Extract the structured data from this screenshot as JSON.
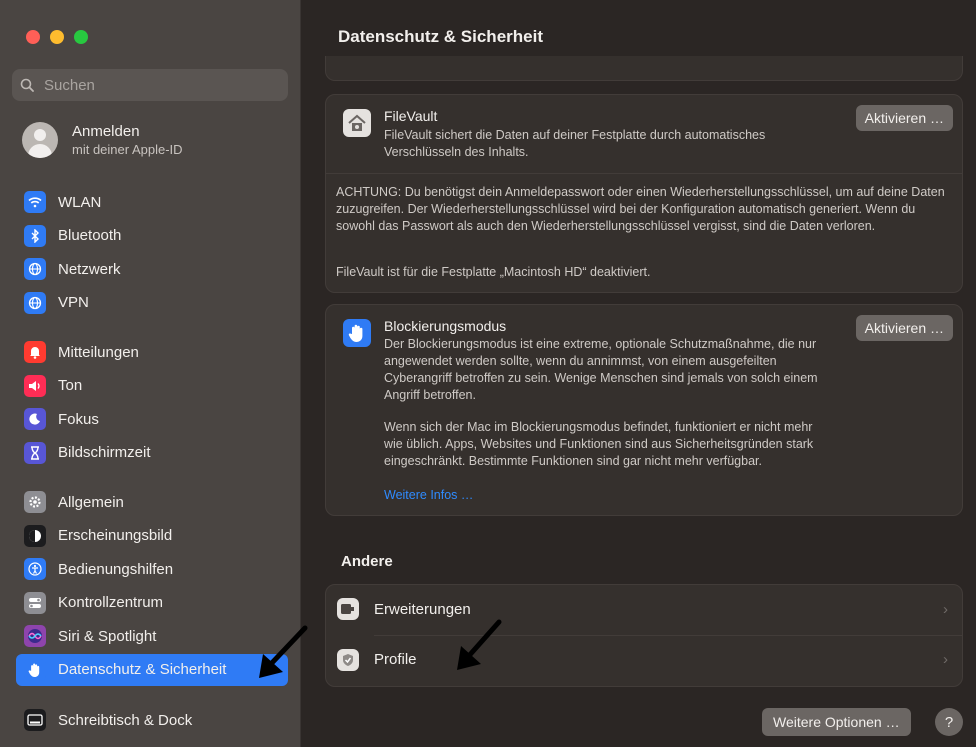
{
  "colors": {
    "accent": "#2f7bf5",
    "traffic_red": "#ff5f57",
    "traffic_yellow": "#febc2e",
    "traffic_green": "#28c840"
  },
  "sidebar": {
    "search_placeholder": "Suchen",
    "account": {
      "title": "Anmelden",
      "subtitle": "mit deiner Apple-ID"
    },
    "groups": [
      [
        {
          "label": "WLAN",
          "icon": "wifi-icon",
          "color": "#2f7bf5"
        },
        {
          "label": "Bluetooth",
          "icon": "bluetooth-icon",
          "color": "#2f7bf5"
        },
        {
          "label": "Netzwerk",
          "icon": "globe-icon",
          "color": "#2f7bf5"
        },
        {
          "label": "VPN",
          "icon": "vpn-globe-icon",
          "color": "#2f7bf5"
        }
      ],
      [
        {
          "label": "Mitteilungen",
          "icon": "bell-icon",
          "color": "#ff3b30"
        },
        {
          "label": "Ton",
          "icon": "speaker-icon",
          "color": "#ff2d55"
        },
        {
          "label": "Fokus",
          "icon": "moon-icon",
          "color": "#5856d6"
        },
        {
          "label": "Bildschirmzeit",
          "icon": "hourglass-icon",
          "color": "#5856d6"
        }
      ],
      [
        {
          "label": "Allgemein",
          "icon": "gear-icon",
          "color": "#8e8e93"
        },
        {
          "label": "Erscheinungsbild",
          "icon": "appearance-icon",
          "color": "#1c1c1e"
        },
        {
          "label": "Bedienungshilfen",
          "icon": "accessibility-icon",
          "color": "#2f7bf5"
        },
        {
          "label": "Kontrollzentrum",
          "icon": "toggles-icon",
          "color": "#8e8e93"
        },
        {
          "label": "Siri & Spotlight",
          "icon": "siri-icon",
          "color": "#8e44ad"
        },
        {
          "label": "Datenschutz & Sicherheit",
          "icon": "hand-icon",
          "color": "#2f7bf5",
          "active": true
        }
      ],
      [
        {
          "label": "Schreibtisch & Dock",
          "icon": "dock-icon",
          "color": "#1c1c1e"
        }
      ]
    ]
  },
  "main": {
    "title": "Datenschutz & Sicherheit",
    "filevault": {
      "title": "FileVault",
      "description": "FileVault sichert die Daten auf deiner Festplatte durch automatisches Verschlüsseln des Inhalts.",
      "button": "Aktivieren …",
      "warning": "ACHTUNG: Du benötigst dein Anmeldepasswort oder einen Wiederherstellungsschlüssel, um auf deine Daten zuzugreifen. Der Wiederherstellungsschlüssel wird bei der Konfiguration automatisch generiert. Wenn du sowohl das Passwort als auch den Wiederherstellungsschlüssel vergisst, sind die Daten verloren.",
      "status": "FileVault ist für die Festplatte „Macintosh HD“ deaktiviert."
    },
    "lockdown": {
      "title": "Blockierungsmodus",
      "description": "Der Blockierungsmodus ist eine extreme, optionale Schutzmaßnahme, die nur angewendet werden sollte, wenn du annimmst, von einem ausgefeilten Cyberangriff betroffen zu sein. Wenige Menschen sind jemals von solch einem Angriff betroffen.",
      "description2": "Wenn sich der Mac im Blockierungsmodus befindet, funktioniert er nicht mehr wie üblich. Apps, Websites und Funktionen sind aus Sicherheitsgründen stark eingeschränkt. Bestimmte Funktionen sind gar nicht mehr verfügbar.",
      "link": "Weitere Infos …",
      "button": "Aktivieren …"
    },
    "other": {
      "section_title": "Andere",
      "items": [
        {
          "label": "Erweiterungen",
          "icon": "extensions-icon"
        },
        {
          "label": "Profile",
          "icon": "profile-check-icon"
        }
      ]
    },
    "footer": {
      "more_options": "Weitere Optionen …",
      "help": "?"
    }
  }
}
